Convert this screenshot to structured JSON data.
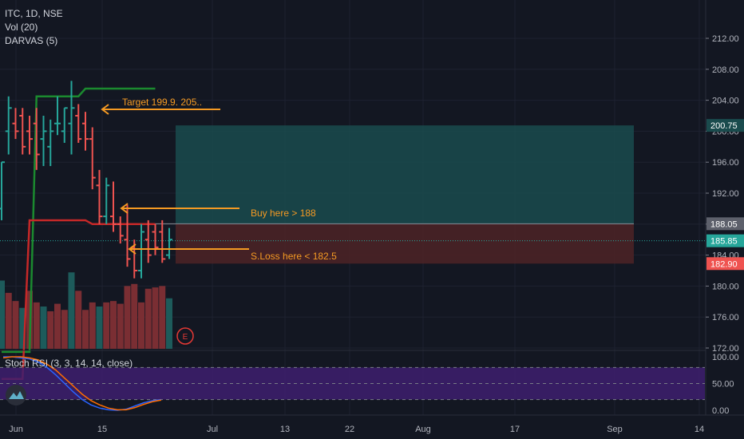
{
  "symbol_line": "ITC, 1D, NSE",
  "indicators": [
    "Vol (20)",
    "DARVAS (5)"
  ],
  "rsi_title": "Stoch RSI (3, 3, 14, 14, close)",
  "colors": {
    "background": "#131722",
    "up": "#26a69a",
    "down": "#ef5350",
    "vol_up": "#1d5b5b",
    "vol_down": "#7a2e33",
    "darvas_top": "#1b8a2f",
    "darvas_bottom": "#c62828",
    "annotation": "#f59a23",
    "rsi_k": "#2962ff",
    "rsi_d": "#ff6d00",
    "rsi_band": "#3e1f6e",
    "target_box": "#1a4b4d",
    "stop_box": "#4a2226"
  },
  "annotations": {
    "target": "Target 199.9. 205..",
    "buy": "Buy here > 188",
    "stop": "S.Loss here < 182.5",
    "event_marker": "E"
  },
  "price_tags": {
    "target": "200.75",
    "entry": "188.05",
    "last": "185.85",
    "stop": "182.90",
    "hidden_tick": "184.00"
  },
  "chart_data": [
    {
      "type": "ohlc",
      "x_axis_labels": [
        "Jun",
        "15",
        "Jul",
        "13",
        "22",
        "Aug",
        "17",
        "Sep",
        "14"
      ],
      "y_ticks": [
        172,
        176,
        180,
        184,
        188,
        192,
        196,
        200,
        204,
        208,
        212
      ],
      "ylim": [
        169,
        214
      ],
      "bars": [
        {
          "o": 190,
          "h": 196,
          "l": 188.5,
          "c": 196
        },
        {
          "o": 200,
          "h": 204.5,
          "l": 197,
          "c": 203
        },
        {
          "o": 201,
          "h": 203,
          "l": 199,
          "c": 200
        },
        {
          "o": 202,
          "h": 203,
          "l": 197,
          "c": 198
        },
        {
          "o": 200,
          "h": 202,
          "l": 197,
          "c": 199
        },
        {
          "o": 201,
          "h": 203,
          "l": 195,
          "c": 197
        },
        {
          "o": 199,
          "h": 202,
          "l": 195.5,
          "c": 200
        },
        {
          "o": 198,
          "h": 201.5,
          "l": 195.5,
          "c": 200
        },
        {
          "o": 201,
          "h": 204.5,
          "l": 199.5,
          "c": 201
        },
        {
          "o": 200,
          "h": 203,
          "l": 198.5,
          "c": 203
        },
        {
          "o": 201,
          "h": 206.5,
          "l": 197,
          "c": 203
        },
        {
          "o": 202,
          "h": 203.5,
          "l": 198.5,
          "c": 199
        },
        {
          "o": 201,
          "h": 202.5,
          "l": 197.5,
          "c": 199
        },
        {
          "o": 199,
          "h": 200.5,
          "l": 192.5,
          "c": 194
        },
        {
          "o": 193,
          "h": 195,
          "l": 188,
          "c": 189
        },
        {
          "o": 189,
          "h": 194,
          "l": 188,
          "c": 193
        },
        {
          "o": 189,
          "h": 193.5,
          "l": 187,
          "c": 188
        },
        {
          "o": 188,
          "h": 189,
          "l": 185.5,
          "c": 186.5
        },
        {
          "o": 186,
          "h": 190.5,
          "l": 182.5,
          "c": 183.5
        },
        {
          "o": 185,
          "h": 186,
          "l": 181,
          "c": 182
        },
        {
          "o": 182,
          "h": 188,
          "l": 181,
          "c": 187
        },
        {
          "o": 186,
          "h": 188.5,
          "l": 183,
          "c": 184
        },
        {
          "o": 187,
          "h": 188,
          "l": 184,
          "c": 185
        },
        {
          "o": 187,
          "h": 188.5,
          "l": 183,
          "c": 183.5
        },
        {
          "o": 184,
          "h": 187.5,
          "l": 183.5,
          "c": 186
        }
      ],
      "volume": [
        {
          "v": 1.0,
          "up": true
        },
        {
          "v": 0.82,
          "up": false
        },
        {
          "v": 0.7,
          "up": false
        },
        {
          "v": 0.6,
          "up": true
        },
        {
          "v": 0.85,
          "up": false
        },
        {
          "v": 0.68,
          "up": false
        },
        {
          "v": 0.62,
          "up": true
        },
        {
          "v": 0.55,
          "up": false
        },
        {
          "v": 0.66,
          "up": false
        },
        {
          "v": 0.57,
          "up": false
        },
        {
          "v": 1.12,
          "up": true
        },
        {
          "v": 0.85,
          "up": false
        },
        {
          "v": 0.57,
          "up": false
        },
        {
          "v": 0.68,
          "up": false
        },
        {
          "v": 0.62,
          "up": true
        },
        {
          "v": 0.68,
          "up": false
        },
        {
          "v": 0.7,
          "up": false
        },
        {
          "v": 0.66,
          "up": false
        },
        {
          "v": 0.92,
          "up": false
        },
        {
          "v": 0.95,
          "up": false
        },
        {
          "v": 0.68,
          "up": false
        },
        {
          "v": 0.88,
          "up": false
        },
        {
          "v": 0.9,
          "up": false
        },
        {
          "v": 0.92,
          "up": false
        },
        {
          "v": 0.74,
          "up": true
        }
      ],
      "darvas_top": [
        [
          0,
          171.5
        ],
        [
          4,
          171.5
        ],
        [
          5,
          204.5
        ],
        [
          11,
          204.5
        ],
        [
          12,
          205.5
        ],
        [
          22,
          205.5
        ]
      ],
      "darvas_bottom": [
        [
          0,
          168
        ],
        [
          3,
          168
        ],
        [
          4,
          188.5
        ],
        [
          12,
          188.5
        ],
        [
          13,
          188.0
        ],
        [
          22,
          188.0
        ]
      ],
      "target_zone": {
        "from_bar": 25,
        "to_bar": 89,
        "low": 188.05,
        "high": 200.75
      },
      "stop_zone": {
        "from_bar": 25,
        "to_bar": 89,
        "low": 182.9,
        "high": 188.05
      }
    },
    {
      "type": "line",
      "title": "Stoch RSI (3, 3, 14, 14, close)",
      "y_ticks": [
        0,
        50,
        100
      ],
      "band": [
        20,
        80
      ],
      "series": [
        {
          "values": [
            100,
            100,
            98,
            96,
            90,
            80,
            66,
            50,
            34,
            20,
            10,
            4,
            1,
            0,
            2,
            8,
            14,
            18,
            20
          ]
        },
        {
          "values": [
            98,
            100,
            100,
            98,
            94,
            86,
            75,
            60,
            45,
            30,
            18,
            10,
            4,
            1,
            1,
            5,
            11,
            16,
            19
          ]
        }
      ]
    }
  ]
}
